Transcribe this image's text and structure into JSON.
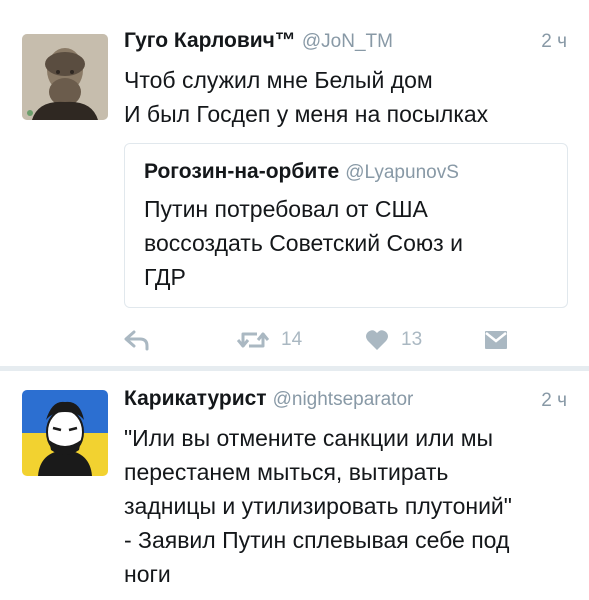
{
  "tweets": [
    {
      "author_name": "Гуго Карлович™",
      "handle": "@JoN_TM",
      "time": "2 ч",
      "lines": [
        "Чтоб служил мне Белый дом",
        "И был Госдеп у меня на посылках"
      ],
      "quote": {
        "author_name": "Рогозин-на-орбите",
        "handle": "@LyapunovS",
        "lines": [
          "Путин потребовал от США",
          "воссоздать Советский Союз и",
          "ГДР"
        ]
      },
      "actions": {
        "reply_icon": "reply-icon",
        "retweet_icon": "retweet-icon",
        "retweet_count": "14",
        "like_icon": "heart-icon",
        "like_count": "13",
        "dm_icon": "direct-message-icon"
      }
    },
    {
      "author_name": "Карикатурист",
      "handle": "@nightseparator",
      "time": "2 ч",
      "lines": [
        "\"Или вы отмените санкции или мы",
        "перестанем мыться, вытирать",
        "задницы и утилизировать плутоний\"",
        "- Заявил Путин сплевывая себе под",
        "ноги"
      ]
    }
  ],
  "colors": {
    "text": "#14171a",
    "secondary": "#8899a6",
    "icon": "#aab8c2",
    "divider": "#e6ecf0",
    "border": "#e1e8ed",
    "flag_blue": "#2c6fd1",
    "flag_yellow": "#f2d230"
  }
}
